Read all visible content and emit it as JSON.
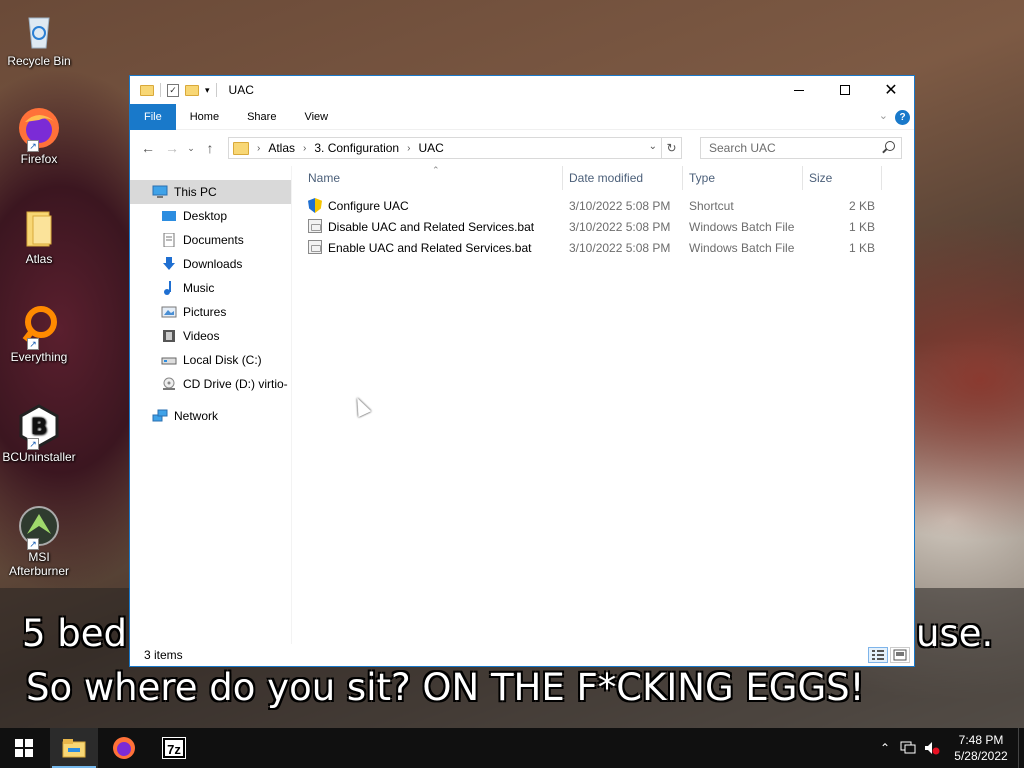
{
  "desktop": {
    "icons": [
      {
        "label": "Recycle Bin"
      },
      {
        "label": "Firefox"
      },
      {
        "label": "Atlas"
      },
      {
        "label": "Everything"
      },
      {
        "label": "BCUninstaller"
      },
      {
        "label": "MSI Afterburner"
      }
    ],
    "caption_line1": "5 bed",
    "caption_line1_end": "use.",
    "caption_line2": "So where do you sit? ON THE F*CKING EGGS!"
  },
  "window": {
    "title": "UAC",
    "ribbon_tabs": [
      "File",
      "Home",
      "Share",
      "View"
    ],
    "help_label": "?",
    "breadcrumb": [
      "Atlas",
      "3. Configuration",
      "UAC"
    ],
    "search_placeholder": "Search UAC",
    "nav_pane": [
      {
        "label": "This PC",
        "selected": true
      },
      {
        "label": "Desktop"
      },
      {
        "label": "Documents"
      },
      {
        "label": "Downloads"
      },
      {
        "label": "Music"
      },
      {
        "label": "Pictures"
      },
      {
        "label": "Videos"
      },
      {
        "label": "Local Disk (C:)"
      },
      {
        "label": "CD Drive (D:) virtio-"
      },
      {
        "label": "Network"
      }
    ],
    "columns": [
      "Name",
      "Date modified",
      "Type",
      "Size"
    ],
    "files": [
      {
        "name": "Configure UAC",
        "date": "3/10/2022 5:08 PM",
        "type": "Shortcut",
        "size": "2 KB",
        "icon": "shield-shortcut-icon"
      },
      {
        "name": "Disable UAC and Related Services.bat",
        "date": "3/10/2022 5:08 PM",
        "type": "Windows Batch File",
        "size": "1 KB",
        "icon": "batch-file-icon"
      },
      {
        "name": "Enable UAC and Related Services.bat",
        "date": "3/10/2022 5:08 PM",
        "type": "Windows Batch File",
        "size": "1 KB",
        "icon": "batch-file-icon"
      }
    ],
    "status_text": "3 items"
  },
  "taskbar": {
    "time": "7:48 PM",
    "date": "5/28/2022",
    "apps": [
      "File Explorer",
      "Firefox",
      "7-Zip"
    ],
    "sevenzip_label": "7z"
  },
  "colors": {
    "accent": "#1979ca",
    "taskbar": "#101010"
  }
}
